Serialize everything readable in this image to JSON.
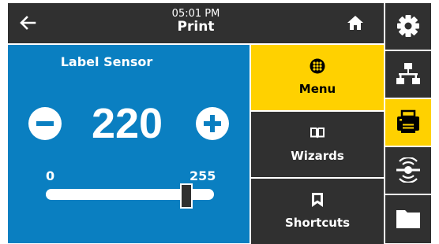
{
  "header": {
    "time": "05:01 PM",
    "title": "Print",
    "back_icon": "arrow-left-icon",
    "home_icon": "home-icon"
  },
  "panel": {
    "title": "Label Sensor",
    "value": "220",
    "min": "0",
    "max": "255",
    "slider_level": 0.8627,
    "color": "#0a7fc1"
  },
  "menu": [
    {
      "label": "Menu",
      "icon": "grid-dots-icon",
      "active": true
    },
    {
      "label": "Wizards",
      "icon": "book-icon",
      "active": false
    },
    {
      "label": "Shortcuts",
      "icon": "bookmark-icon",
      "active": false
    }
  ],
  "sidebar": [
    {
      "icon": "gear-icon",
      "active": false
    },
    {
      "icon": "network-icon",
      "active": false
    },
    {
      "icon": "printer-icon",
      "active": true
    },
    {
      "icon": "wireless-icon",
      "active": false
    },
    {
      "icon": "folder-icon",
      "active": false
    }
  ],
  "colors": {
    "accent": "#ffd100",
    "dark": "#303030",
    "panel": "#0a7fc1"
  }
}
